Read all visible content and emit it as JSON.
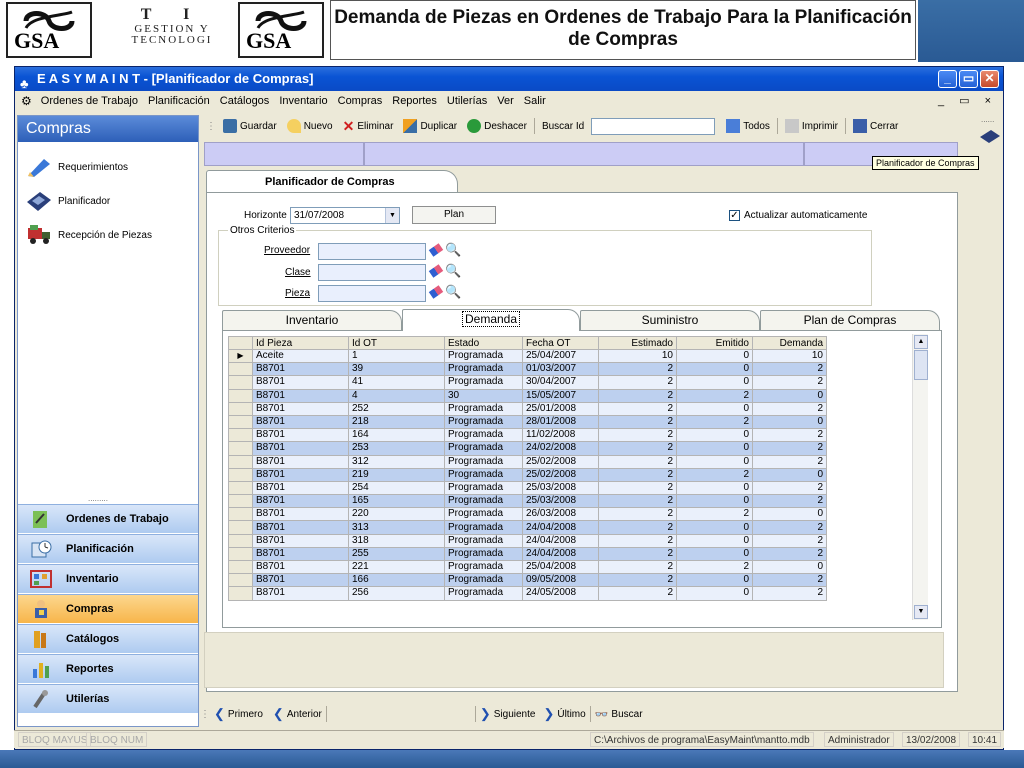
{
  "banner": {
    "logo_left_text": "GSA",
    "ti_line1": "T I",
    "ti_line2": "GESTION Y",
    "ti_line3": "TECNOLOGI",
    "logo_right_text": "GSA",
    "title": "Demanda de Piezas en Ordenes de Trabajo Para la Planificación de Compras"
  },
  "window": {
    "title": "E A S Y    M A I N T  - [Planificador de Compras]",
    "controls": [
      "_",
      "▭",
      "✕"
    ],
    "mdi_controls": "_ ▭ ×"
  },
  "menu": {
    "items": [
      "Ordenes de Trabajo",
      "Planificación",
      "Catálogos",
      "Inventario",
      "Compras",
      "Reportes",
      "Utilerías",
      "Ver",
      "Salir"
    ]
  },
  "sidebar": {
    "header": "Compras",
    "items": [
      {
        "label": "Requerimientos",
        "icon": "pencil-icon"
      },
      {
        "label": "Planificador",
        "icon": "calculator-icon"
      },
      {
        "label": "Recepción de Piezas",
        "icon": "truck-icon"
      }
    ],
    "nav": [
      {
        "label": "Ordenes de Trabajo",
        "icon": "clipboard-icon",
        "active": false
      },
      {
        "label": "Planificación",
        "icon": "calendar-clock-icon",
        "active": false
      },
      {
        "label": "Inventario",
        "icon": "shelves-icon",
        "active": false
      },
      {
        "label": "Compras",
        "icon": "buyer-icon",
        "active": true
      },
      {
        "label": "Catálogos",
        "icon": "books-icon",
        "active": false
      },
      {
        "label": "Reportes",
        "icon": "bar-chart-icon",
        "active": false
      },
      {
        "label": "Utilerías",
        "icon": "tools-icon",
        "active": false
      }
    ]
  },
  "toolbar": {
    "save": "Guardar",
    "new": "Nuevo",
    "delete": "Eliminar",
    "duplicate": "Duplicar",
    "undo": "Deshacer",
    "search_id_label": "Buscar Id",
    "search_id_value": "",
    "all": "Todos",
    "print": "Imprimir",
    "close": "Cerrar"
  },
  "tooltip": "Planificador de Compras",
  "panel": {
    "tab_title": "Planificador de Compras",
    "horizon_label": "Horizonte",
    "horizon_value": "31/07/2008",
    "plan_button": "Plan",
    "auto_update_label": "Actualizar automaticamente",
    "auto_update_checked": true,
    "criteria_title": "Otros Criterios",
    "criteria": [
      {
        "label": "Proveedor",
        "value": ""
      },
      {
        "label": "Clase",
        "value": ""
      },
      {
        "label": "Pieza",
        "value": ""
      }
    ]
  },
  "tabs": [
    "Inventario",
    "Demanda",
    "Suministro",
    "Plan de Compras"
  ],
  "active_tab": "Demanda",
  "grid": {
    "columns": [
      "Id Pieza",
      "Id OT",
      "Estado",
      "Fecha OT",
      "Estimado",
      "Emitido",
      "Demanda"
    ],
    "rows": [
      [
        "Aceite",
        "1",
        "Programada",
        "25/04/2007",
        "10",
        "0",
        "10"
      ],
      [
        "B8701",
        "39",
        "Programada",
        "01/03/2007",
        "2",
        "0",
        "2"
      ],
      [
        "B8701",
        "41",
        "Programada",
        "30/04/2007",
        "2",
        "0",
        "2"
      ],
      [
        "B8701",
        "4",
        "30",
        "15/05/2007",
        "2",
        "2",
        "0"
      ],
      [
        "B8701",
        "252",
        "Programada",
        "25/01/2008",
        "2",
        "0",
        "2"
      ],
      [
        "B8701",
        "218",
        "Programada",
        "28/01/2008",
        "2",
        "2",
        "0"
      ],
      [
        "B8701",
        "164",
        "Programada",
        "11/02/2008",
        "2",
        "0",
        "2"
      ],
      [
        "B8701",
        "253",
        "Programada",
        "24/02/2008",
        "2",
        "0",
        "2"
      ],
      [
        "B8701",
        "312",
        "Programada",
        "25/02/2008",
        "2",
        "0",
        "2"
      ],
      [
        "B8701",
        "219",
        "Programada",
        "25/02/2008",
        "2",
        "2",
        "0"
      ],
      [
        "B8701",
        "254",
        "Programada",
        "25/03/2008",
        "2",
        "0",
        "2"
      ],
      [
        "B8701",
        "165",
        "Programada",
        "25/03/2008",
        "2",
        "0",
        "2"
      ],
      [
        "B8701",
        "220",
        "Programada",
        "26/03/2008",
        "2",
        "2",
        "0"
      ],
      [
        "B8701",
        "313",
        "Programada",
        "24/04/2008",
        "2",
        "0",
        "2"
      ],
      [
        "B8701",
        "318",
        "Programada",
        "24/04/2008",
        "2",
        "0",
        "2"
      ],
      [
        "B8701",
        "255",
        "Programada",
        "24/04/2008",
        "2",
        "0",
        "2"
      ],
      [
        "B8701",
        "221",
        "Programada",
        "25/04/2008",
        "2",
        "2",
        "0"
      ],
      [
        "B8701",
        "166",
        "Programada",
        "09/05/2008",
        "2",
        "0",
        "2"
      ],
      [
        "B8701",
        "256",
        "Programada",
        "24/05/2008",
        "2",
        "0",
        "2"
      ]
    ]
  },
  "record_nav": {
    "first": "Primero",
    "prev": "Anterior",
    "next": "Siguiente",
    "last": "Último",
    "search": "Buscar"
  },
  "status": {
    "caps": "BLOQ MAYUS",
    "num": "BLOQ NUM",
    "path": "C:\\Archivos de programa\\EasyMaint\\mantto.mdb",
    "user": "Administrador",
    "date": "13/02/2008",
    "time": "10:41"
  },
  "colors": {
    "titlebar": "#0a54d4",
    "row_blue": "#bdd0ef",
    "row_light": "#eaf0fb",
    "nav_active": "#f7b54a",
    "lavender_strip": "#ccccf5"
  }
}
